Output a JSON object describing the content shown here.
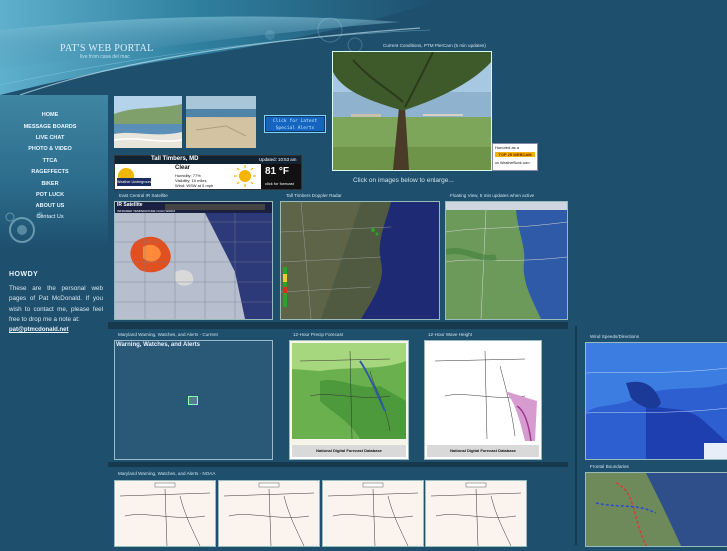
{
  "site": {
    "title": "PAT'S WEB PORTAL",
    "subtitle": "live from casa del mac"
  },
  "nav": [
    {
      "label": "HOME"
    },
    {
      "label": "MESSAGE BOARDS"
    },
    {
      "label": "LIVE CHAT"
    },
    {
      "label": "PHOTO & VIDEO"
    },
    {
      "label": "TTCA"
    },
    {
      "label": "RAGEFFECTS"
    },
    {
      "label": "BIKER"
    },
    {
      "label": "POT LUCK"
    },
    {
      "label": "ABOUT US"
    },
    {
      "label": "Contact Us"
    }
  ],
  "intro": {
    "heading": "HOWDY",
    "body": "These are the personal web pages of Pat McDonald. If you wish to contact me, please feel free to drop me a note at:",
    "email": "pat@ptmcdonald.net"
  },
  "alert_button": {
    "line1": "Click for Latest",
    "line2": "Special Alerts"
  },
  "weather_widget": {
    "location": "Tall Timbers, MD",
    "updated": "Updated: 10:53 am",
    "condition": "Clear",
    "humidity": "Humidity: 77%",
    "visibility": "Visibility: 10 miles",
    "wind": "Wind: WSW at 5 mph",
    "temperature": "81 °F",
    "forecast_link": "click for forecast",
    "brand": "Weather Underground"
  },
  "webcam": {
    "caption": "Current Conditions, PTM PierCam (5 min updates)",
    "enlarge_text": "Click on images below to enlarge..."
  },
  "badge": {
    "line1": "Honored as a",
    "line2": "TOP 25 WEBCAM",
    "line3": "on WeatherBonk.com"
  },
  "maps_row1": [
    {
      "caption": "East Central IR Satellite",
      "header": "IR Satellite",
      "legend": "INFRARED TEMPERATURE COLD WARM"
    },
    {
      "caption": "Tall Timbers Doppler Radar",
      "header": ""
    },
    {
      "caption": "Floating View, 5 min updates when active",
      "header": ""
    }
  ],
  "section2": {
    "caption": "Maryland Warning, Watches, and Alerts - Current",
    "box_title": "Warning, Watches, and Alerts",
    "precip_caption": "12-Hour Precip Forecast",
    "wave_caption": "12-Hour Wave Height",
    "ndfd_label": "National Digital Forecast Database",
    "wind_caption": "Wind Speeds/Directions",
    "frontal_caption": "Frontal Boundaries"
  },
  "section3": {
    "caption": "Maryland Warning, Watches, and Alerts - NOAA"
  },
  "colors": {
    "background": "#1e4f6d",
    "accent": "#3f86a3",
    "link": "#e9f5fb"
  }
}
